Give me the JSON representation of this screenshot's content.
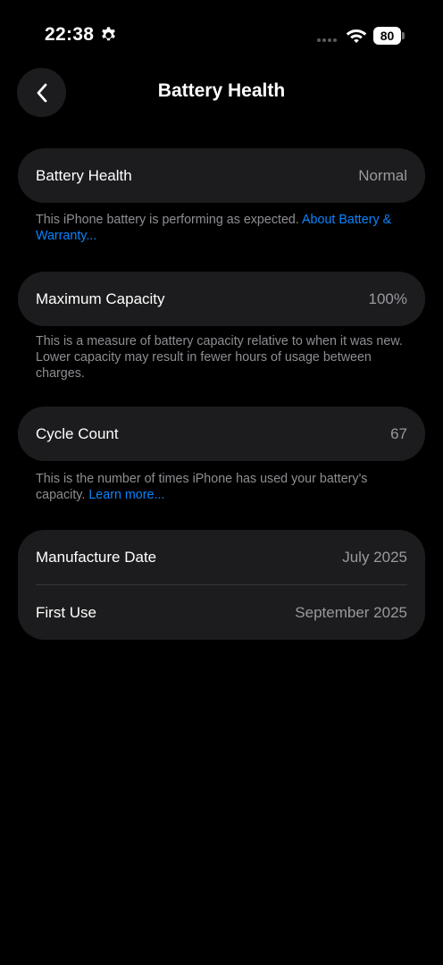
{
  "status_bar": {
    "time": "22:38",
    "battery_level": "80",
    "settings_icon": "gear-icon",
    "wifi_icon": "wifi-icon"
  },
  "nav": {
    "back_icon": "chevron-left-icon",
    "title": "Battery Health"
  },
  "battery_health": {
    "label": "Battery Health",
    "value": "Normal",
    "footnote_text": "This iPhone battery is performing as expected. ",
    "footnote_link": "About Battery & Warranty..."
  },
  "maximum_capacity": {
    "label": "Maximum Capacity",
    "value": "100%",
    "footnote_text": "This is a measure of battery capacity relative to when it was new. Lower capacity may result in fewer hours of usage between charges."
  },
  "cycle_count": {
    "label": "Cycle Count",
    "value": "67",
    "footnote_text": "This is the number of times iPhone has used your battery's capacity. ",
    "footnote_link": "Learn more..."
  },
  "dates": {
    "manufacture_label": "Manufacture Date",
    "manufacture_value": "July 2025",
    "first_use_label": "First Use",
    "first_use_value": "September 2025"
  },
  "colors": {
    "background": "#000000",
    "card": "#1c1c1e",
    "secondary_text": "#98989f",
    "footnote_text": "#8e8e93",
    "link": "#0a84ff"
  }
}
